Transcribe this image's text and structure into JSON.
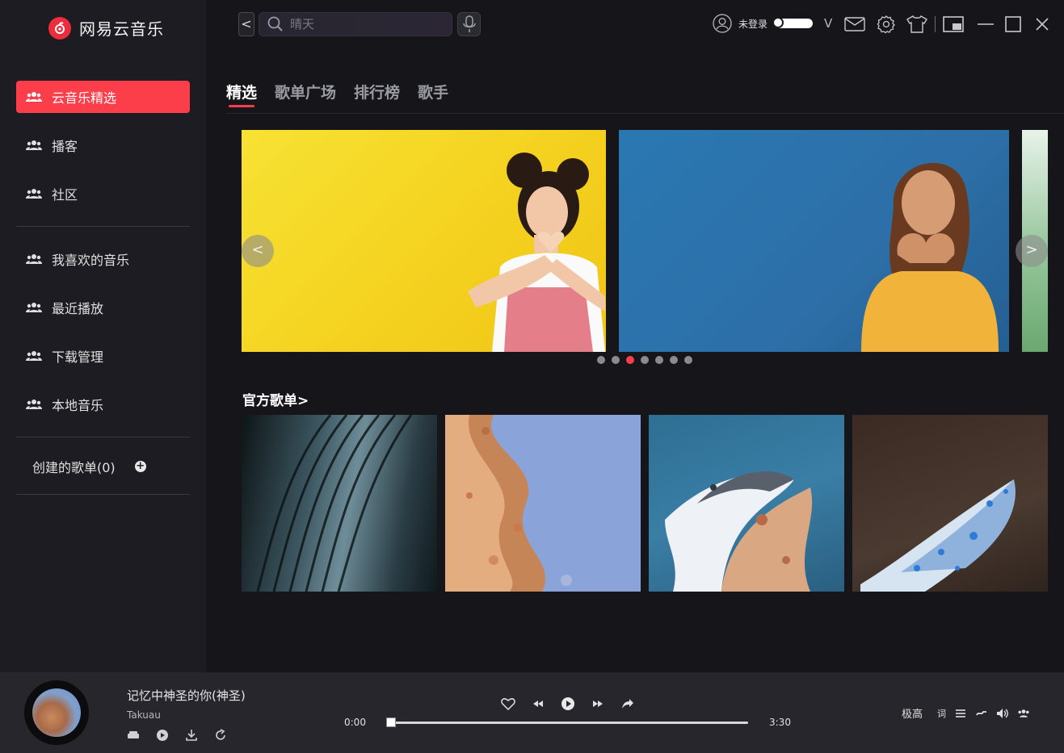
{
  "app": {
    "name": "网易云音乐"
  },
  "sidebar": {
    "items": [
      {
        "label": "云音乐精选",
        "active": true
      },
      {
        "label": "播客"
      },
      {
        "label": "社区"
      },
      {
        "label": "我喜欢的音乐"
      },
      {
        "label": "最近播放"
      },
      {
        "label": "下载管理"
      },
      {
        "label": "本地音乐"
      }
    ],
    "created_playlists": "创建的歌单(0)"
  },
  "topbar": {
    "back": "<",
    "search_placeholder": "晴天",
    "login": "未登录",
    "chevron": "V"
  },
  "tabs": [
    {
      "label": "精选",
      "active": true
    },
    {
      "label": "歌单广场"
    },
    {
      "label": "排行榜"
    },
    {
      "label": "歌手"
    }
  ],
  "carousel": {
    "prev": "<",
    "next": ">",
    "dot_count": 7,
    "active_dot": 3
  },
  "section": {
    "title": "官方歌单>"
  },
  "player": {
    "song_title": "记忆中神圣的你(神圣)",
    "artist": "Takuau",
    "current_time": "0:00",
    "total_time": "3:30",
    "progress": 0,
    "quality": "极高",
    "lyrics": "词"
  },
  "colors": {
    "accent": "#fc3d4a",
    "sidebar_bg": "#1c1c22",
    "main_bg": "#16161a",
    "player_bg": "#26262c"
  }
}
